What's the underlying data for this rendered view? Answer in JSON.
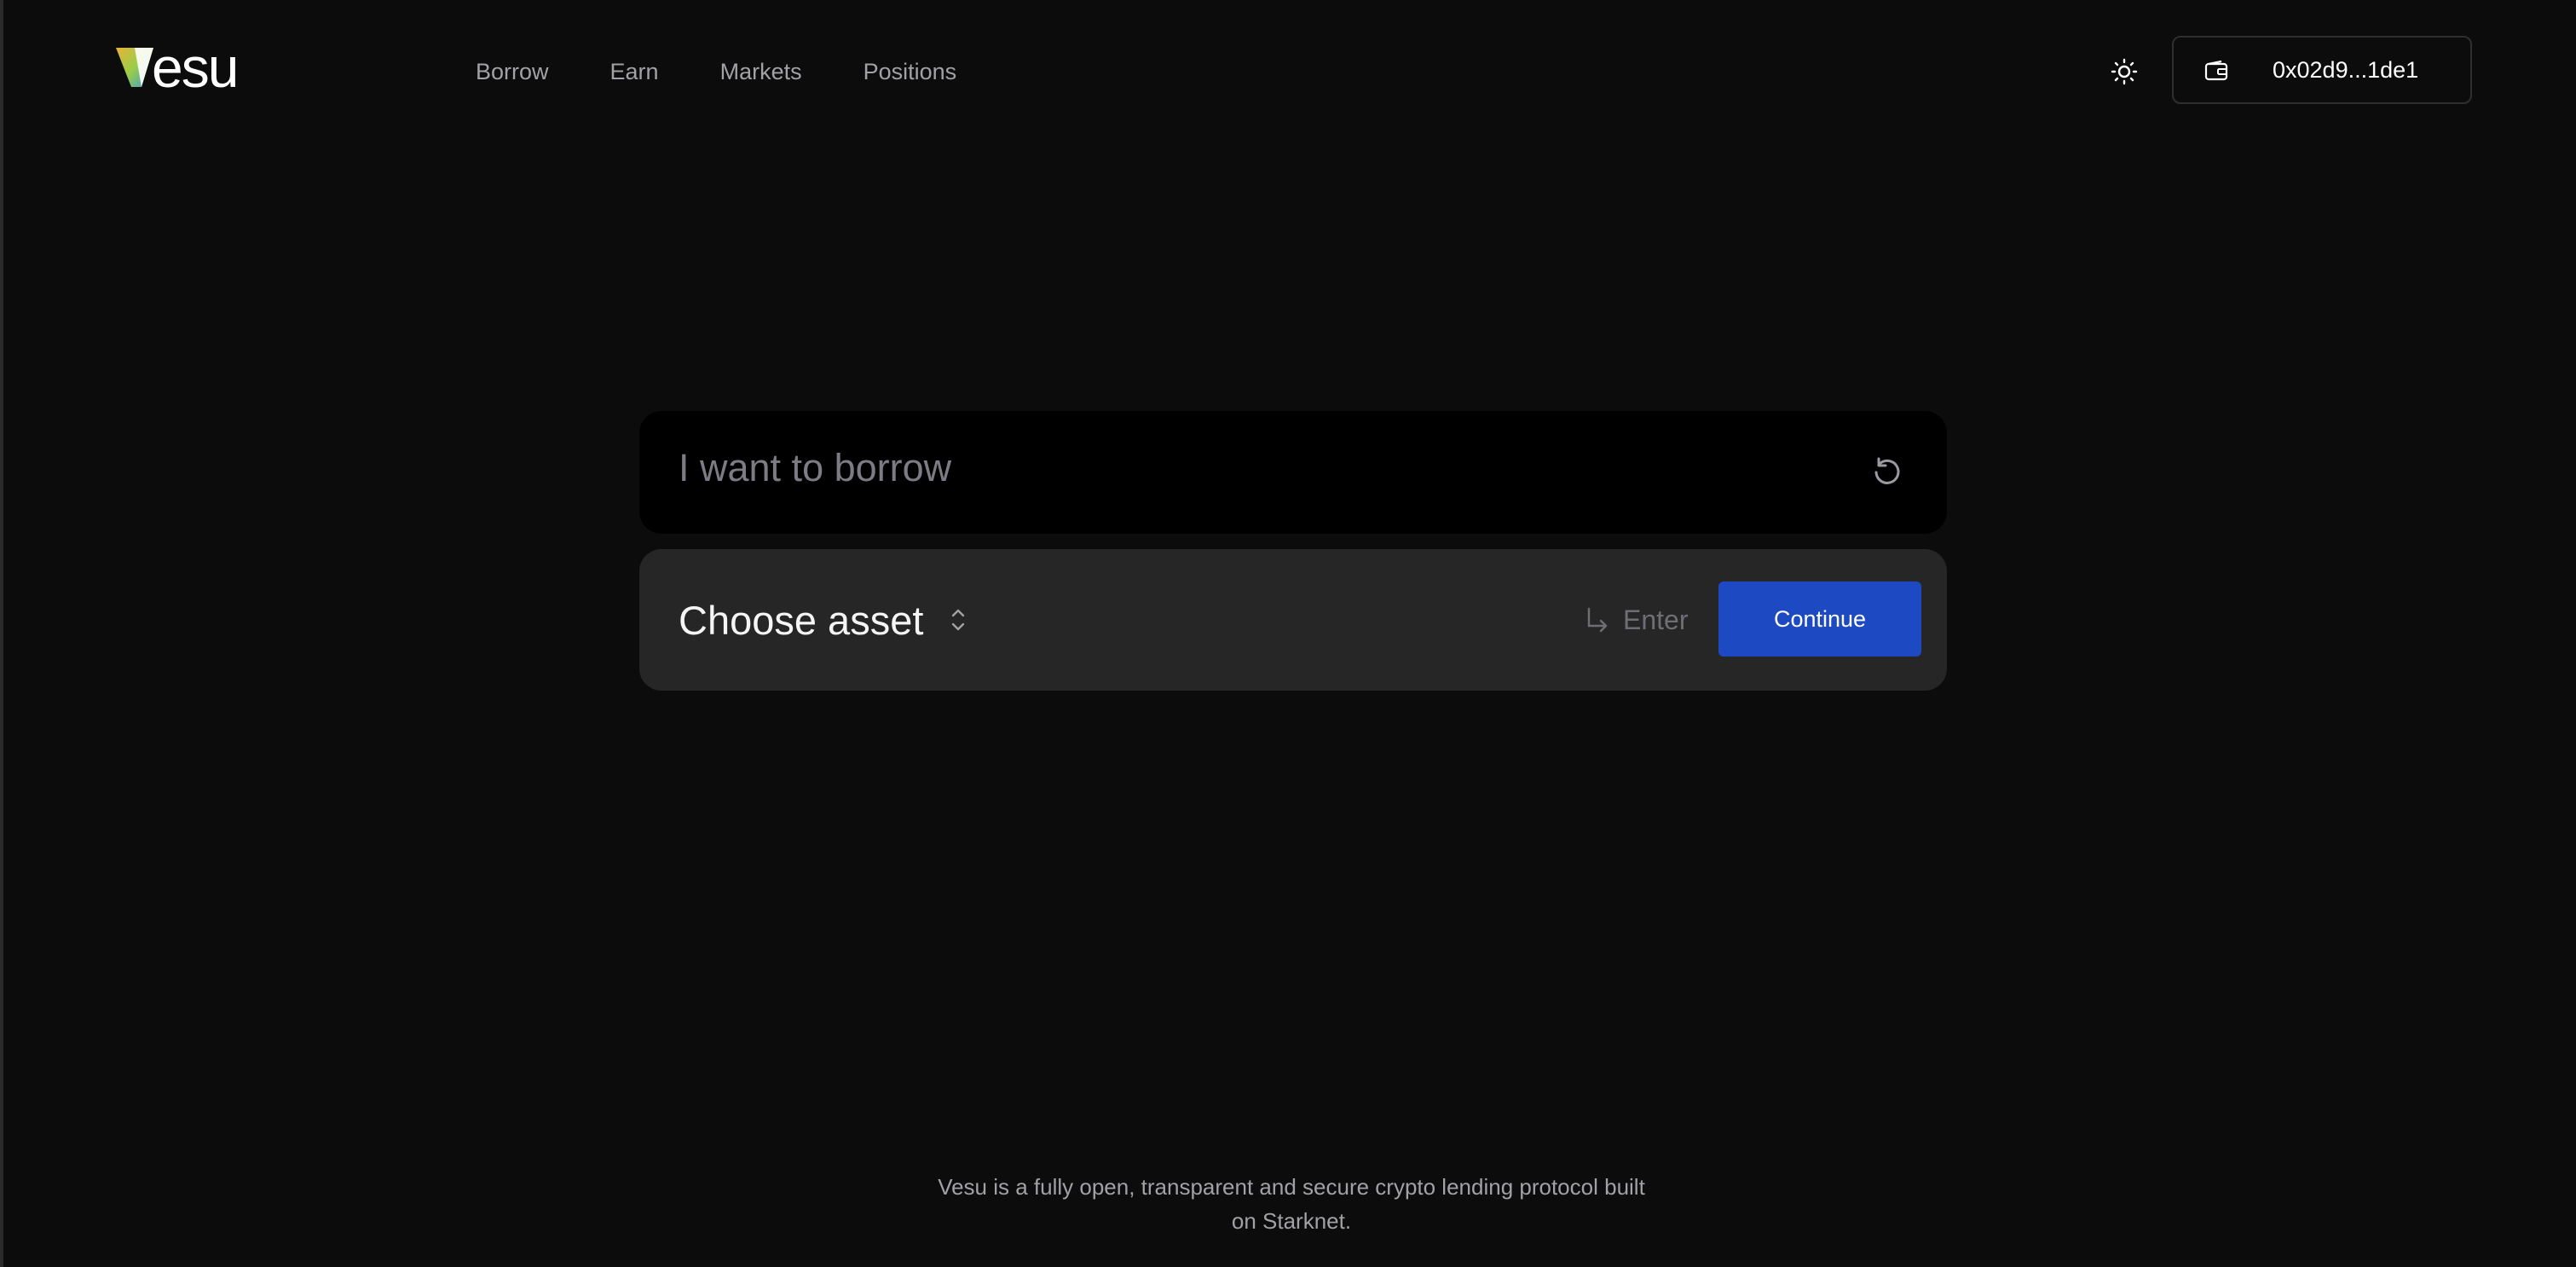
{
  "brand": {
    "name": "vesu",
    "logo_gradient": [
      "#e8b23a",
      "#9acd48",
      "#3a9ad8"
    ]
  },
  "nav": {
    "items": [
      {
        "label": "Borrow"
      },
      {
        "label": "Earn"
      },
      {
        "label": "Markets"
      },
      {
        "label": "Positions"
      }
    ]
  },
  "header": {
    "theme_toggle_icon": "sun-icon",
    "wallet": {
      "icon": "wallet-icon",
      "address": "0x02d9...1de1"
    }
  },
  "prompt": {
    "text": "I want to borrow",
    "reset_icon": "reset-icon"
  },
  "asset": {
    "select_label": "Choose asset",
    "select_icon": "chevron-up-down-icon",
    "enter_icon": "enter-arrow-icon",
    "enter_label": "Enter",
    "continue_label": "Continue",
    "accent_color": "#1d4ac2"
  },
  "footer": {
    "line1": "Vesu is a fully open, transparent and secure crypto lending protocol built",
    "line2": "on Starknet."
  }
}
